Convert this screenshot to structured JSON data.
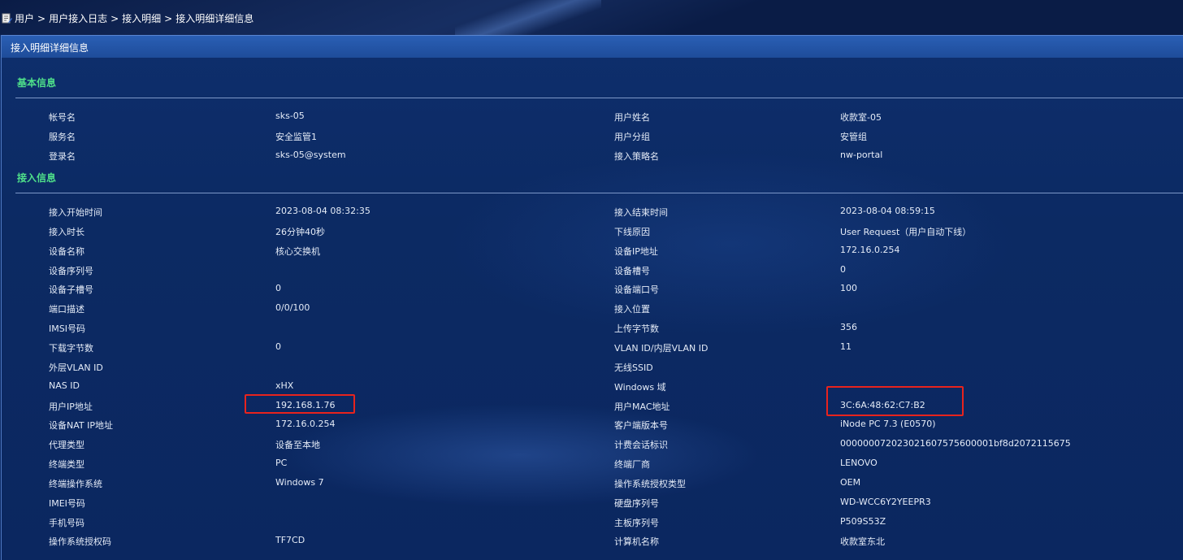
{
  "breadcrumb": {
    "items": [
      "用户",
      "用户接入日志",
      "接入明细",
      "接入明细详细信息"
    ],
    "separator": ">"
  },
  "panel": {
    "title": "接入明细详细信息"
  },
  "basic_info": {
    "title": "基本信息",
    "rows": [
      [
        "帐号名",
        "sks-05",
        "用户姓名",
        "收款室-05"
      ],
      [
        "服务名",
        "安全监管1",
        "用户分组",
        "安管组"
      ],
      [
        "登录名",
        "sks-05@system",
        "接入策略名",
        "nw-portal"
      ]
    ]
  },
  "access_info": {
    "title": "接入信息",
    "rows": [
      [
        "接入开始时间",
        "2023-08-04 08:32:35",
        "接入结束时间",
        "2023-08-04 08:59:15"
      ],
      [
        "接入时长",
        "26分钟40秒",
        "下线原因",
        "User Request（用户自动下线）"
      ],
      [
        "设备名称",
        "核心交换机",
        "设备IP地址",
        "172.16.0.254"
      ],
      [
        "设备序列号",
        "",
        "设备槽号",
        "0"
      ],
      [
        "设备子槽号",
        "0",
        "设备端口号",
        "100"
      ],
      [
        "端口描述",
        "0/0/100",
        "接入位置",
        ""
      ],
      [
        "IMSI号码",
        "",
        "上传字节数",
        "356"
      ],
      [
        "下载字节数",
        "0",
        "VLAN ID/内层VLAN ID",
        "11"
      ],
      [
        "外层VLAN ID",
        "",
        "无线SSID",
        ""
      ],
      [
        "NAS ID",
        "xHX",
        "Windows 域",
        ""
      ],
      [
        "用户IP地址",
        "192.168.1.76",
        "用户MAC地址",
        "3C:6A:48:62:C7:B2"
      ],
      [
        "设备NAT IP地址",
        "172.16.0.254",
        "客户端版本号",
        "iNode PC 7.3 (E0570)"
      ],
      [
        "代理类型",
        "设备至本地",
        "计费会话标识",
        "000000072023021607575600001bf8d2072115675"
      ],
      [
        "终端类型",
        "PC",
        "终端厂商",
        "LENOVO"
      ],
      [
        "终端操作系统",
        "Windows 7",
        "操作系统授权类型",
        "OEM"
      ],
      [
        "IMEI号码",
        "",
        "硬盘序列号",
        "WD-WCC6Y2YEEPR3"
      ],
      [
        "手机号码",
        "",
        "主板序列号",
        "P509S53Z"
      ],
      [
        "操作系统授权码",
        "TF7CD",
        "计算机名称",
        "收款室东北"
      ]
    ]
  },
  "colors": {
    "section_title": "#4fe08a",
    "highlight_border": "#e8231d",
    "header_bg": "#2a5fb5"
  },
  "icons": {
    "breadcrumb": "edit-document-icon"
  }
}
